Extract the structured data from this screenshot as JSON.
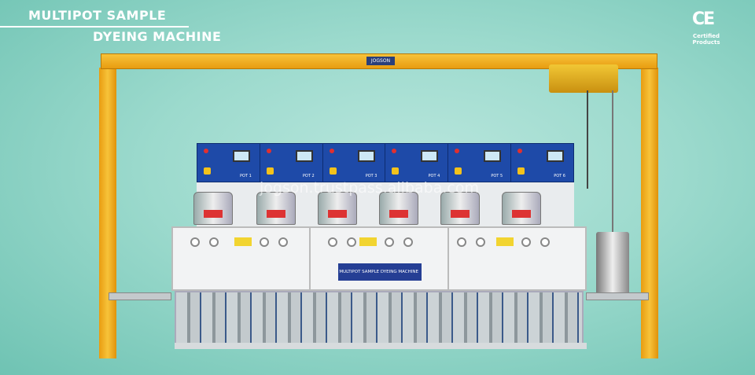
{
  "header": {
    "title_line1": "MULTIPOT SAMPLE",
    "title_line2": "DYEING MACHINE"
  },
  "badge": {
    "mark": "CE",
    "caption_line1": "Certified",
    "caption_line2": "Products"
  },
  "machine": {
    "brand": "JOGSON",
    "nameplate": "MULTIPOT SAMPLE DYEING MACHINE",
    "pots": [
      "POT 1",
      "POT 2",
      "POT 3",
      "POT 4",
      "POT 5",
      "POT 6"
    ]
  },
  "watermark": "jogson.trustpass.alibaba.com"
}
